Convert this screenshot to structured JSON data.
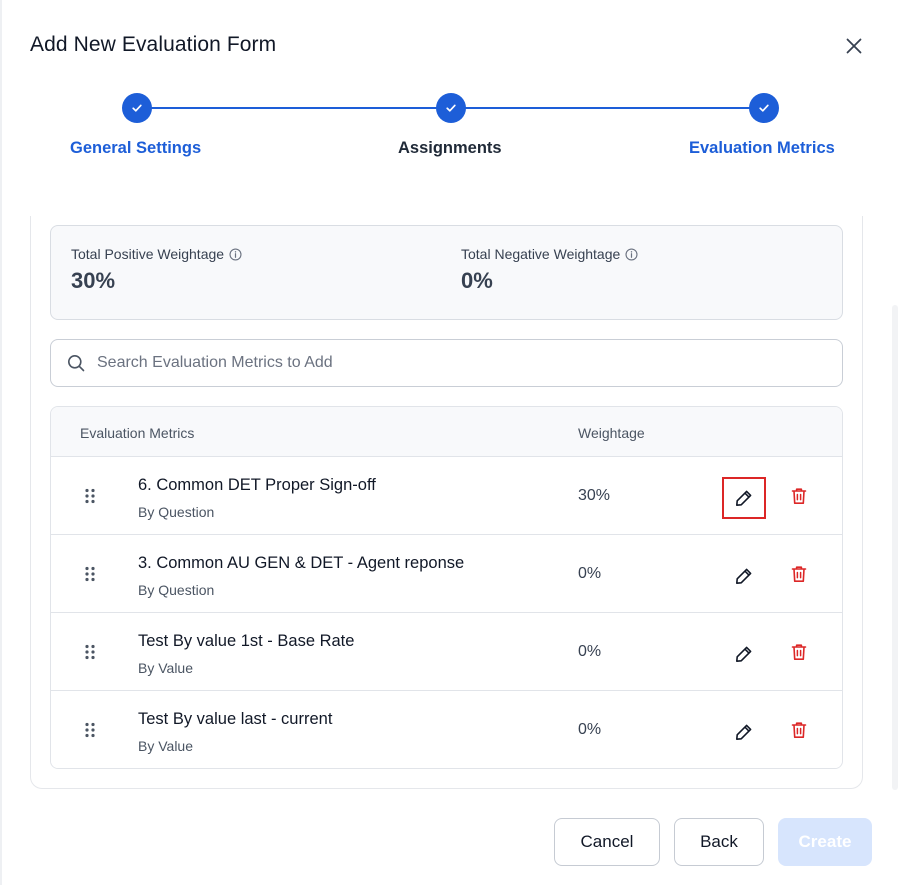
{
  "modal": {
    "title": "Add New Evaluation Form"
  },
  "stepper": {
    "steps": [
      {
        "label": "General Settings",
        "color": "#1d5ed8"
      },
      {
        "label": "Assignments",
        "color": "#1f2937"
      },
      {
        "label": "Evaluation Metrics",
        "color": "#1d5ed8"
      }
    ]
  },
  "summary": {
    "positive": {
      "label": "Total Positive Weightage",
      "value": "30%"
    },
    "negative": {
      "label": "Total Negative Weightage",
      "value": "0%"
    }
  },
  "search": {
    "placeholder": "Search Evaluation Metrics to Add"
  },
  "table": {
    "headers": {
      "metric": "Evaluation Metrics",
      "weightage": "Weightage"
    },
    "rows": [
      {
        "name": "6. Common DET Proper Sign-off",
        "type": "By Question",
        "weightage": "30%"
      },
      {
        "name": "3. Common AU GEN & DET - Agent reponse",
        "type": "By Question",
        "weightage": "0%"
      },
      {
        "name": "Test By value 1st - Base Rate",
        "type": "By Value",
        "weightage": "0%"
      },
      {
        "name": "Test By value last - current",
        "type": "By Value",
        "weightage": "0%"
      }
    ]
  },
  "footer": {
    "cancel": "Cancel",
    "back": "Back",
    "create": "Create"
  },
  "colors": {
    "accent": "#1d5ed8",
    "danger": "#dc2626",
    "disabled": "#d7e5fd"
  },
  "icons": {
    "close": "close-icon",
    "check": "check-icon",
    "info": "info-icon",
    "search": "search-icon",
    "drag": "drag-handle-icon",
    "edit": "pencil-icon",
    "delete": "trash-icon"
  }
}
